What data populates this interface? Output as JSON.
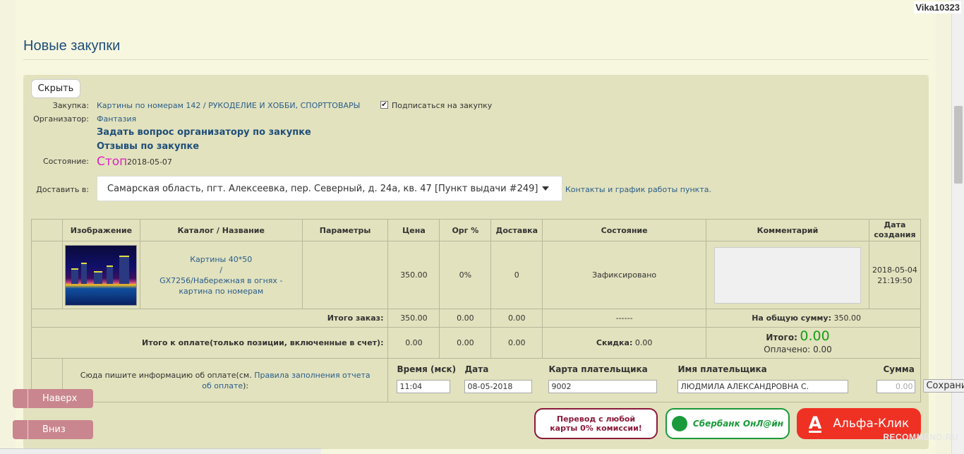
{
  "user": {
    "name": "Vika10323"
  },
  "page_title": "Новые закупки",
  "hide_button": "Скрыть",
  "info": {
    "zakupka_label": "Закупка:",
    "zakupka_value": "Картины по номерам 142 / РУКОДЕЛИЕ И ХОББИ, СПОРТТОВАРЫ",
    "subscribe_label": "Подписаться на закупку",
    "subscribe_checked": "✔",
    "organizer_label": "Организатор:",
    "organizer_value": "Фантазия",
    "ask_link": "Задать вопрос организатору по закупке",
    "reviews_link": "Отзывы по закупке",
    "status_label": "Состояние:",
    "status_value": "Стоп",
    "status_date": "2018-05-07",
    "deliver_label": "Доставить в:",
    "deliver_value": "Самарская область, пгт. Алексеевка, пер. Северный, д. 24а, кв. 47 [Пункт выдачи #249]",
    "contacts_link": "Контакты и график работы пункта."
  },
  "table": {
    "headers": [
      "Изображение",
      "Каталог / Название",
      "Параметры",
      "Цена",
      "Орг %",
      "Доставка",
      "Состояние",
      "Комментарий",
      "Дата создания"
    ],
    "row": {
      "catalog": "Картины 40*50",
      "sep": "/",
      "name": "GX7256/Набережная в огнях - картина по номерам",
      "params": "",
      "price": "350.00",
      "org": "0%",
      "delivery": "0",
      "state": "Зафиксировано",
      "date": "2018-05-04",
      "time": "21:19:50"
    },
    "total_order": {
      "label": "Итого заказ:",
      "price": "350.00",
      "org": "0.00",
      "delivery": "0.00",
      "state": "------",
      "sum_label": "На общую сумму:",
      "sum_value": "350.00"
    },
    "total_pay": {
      "label": "Итого к оплате(только позиции, включенные в счет):",
      "price": "0.00",
      "org": "0.00",
      "delivery": "0.00",
      "discount_label": "Скидка:",
      "discount_value": "0.00",
      "itogo_label": "Итого:",
      "itogo_value": "0.00",
      "paid_label": "Оплачено:",
      "paid_value": "0.00"
    },
    "payment": {
      "hint_text": "Сюда пишите информацию об оплате(см.",
      "hint_link": "Правила заполнения отчета об оплате",
      "hint_end": "):",
      "time_label": "Время (мск)",
      "time_value": "11:04",
      "date_label": "Дата",
      "date_value": "08-05-2018",
      "card_label": "Карта плательщика",
      "card_value": "9002",
      "name_label": "Имя плательщика",
      "name_value": "ЛЮДМИЛА АЛЕКСАНДРОВНА С.",
      "sum_label": "Сумма",
      "sum_placeholder": "0.00",
      "save_button": "Сохранить"
    }
  },
  "side_buttons": {
    "up": "Наверх",
    "down": "Вниз"
  },
  "payment_buttons": {
    "transfer": "Перевод с любой карты 0% комиссии!",
    "sberbank": "Сбербанк ОнЛ@йн",
    "alfa": "Альфа-Клик",
    "alfa_logo": "А"
  },
  "watermark": "RECOMMEND.RU",
  "colors": {
    "title": "#1f4e79",
    "link": "#2a5d8a",
    "stop": "#e020c0",
    "fixed": "#e8870b",
    "itogo": "#1a9a1a",
    "alfa": "#ef3124",
    "sber": "#1a9a3a"
  }
}
